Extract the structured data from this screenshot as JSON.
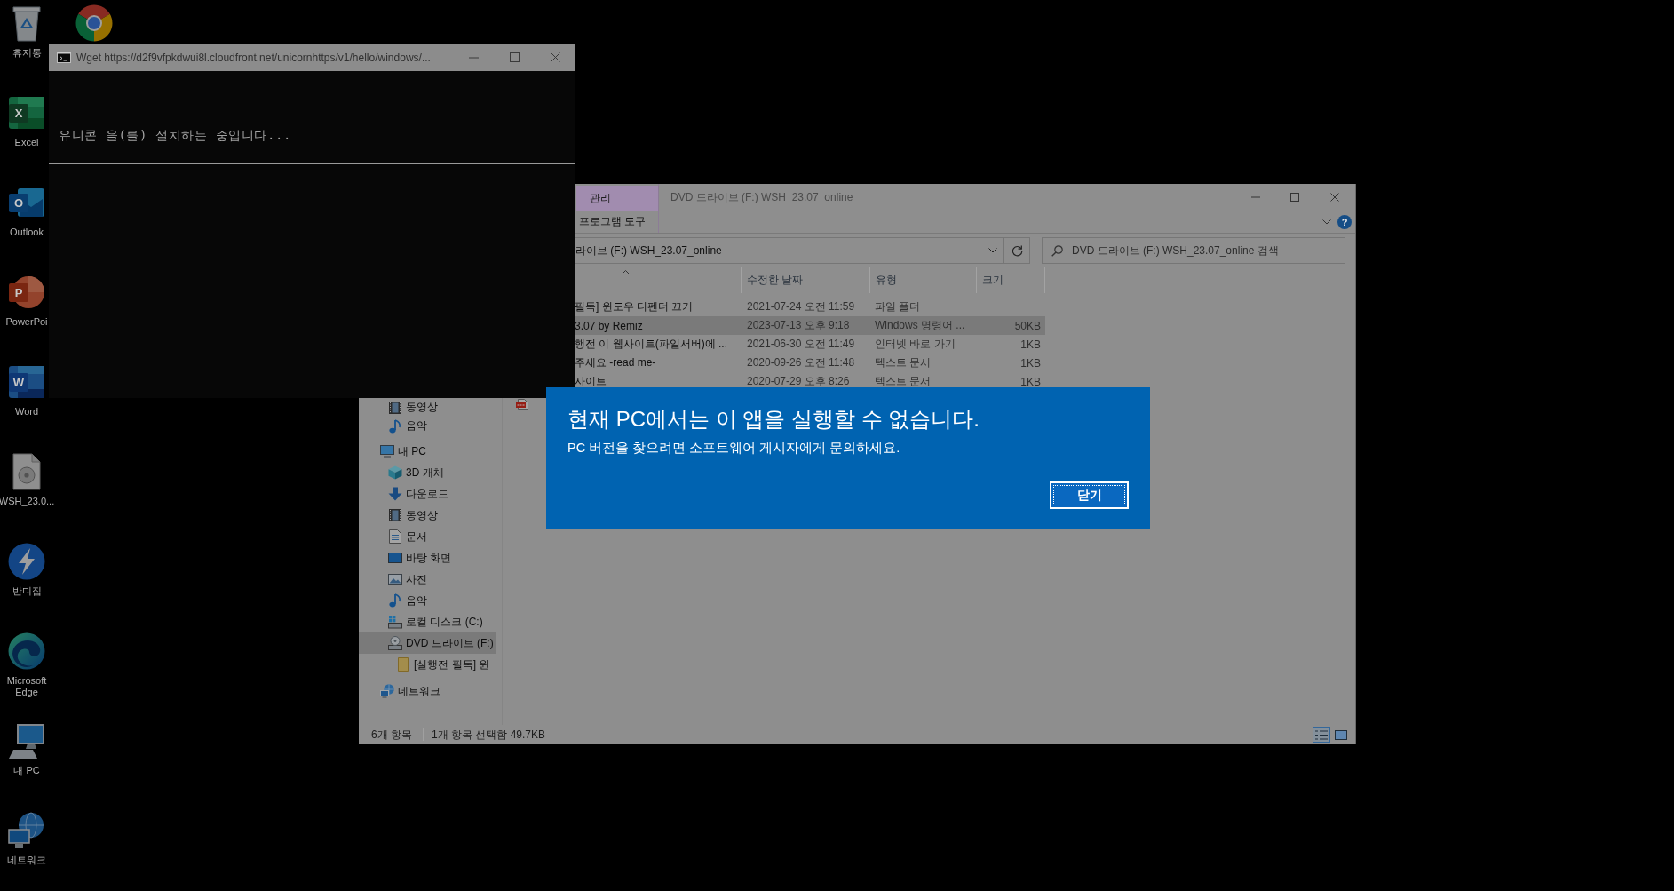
{
  "desktop_icons": [
    {
      "kind": "recycle-bin",
      "label": "휴지통"
    },
    {
      "kind": "spreadsheet",
      "glyph": "X",
      "label": "Excel"
    },
    {
      "kind": "mail",
      "glyph": "O",
      "label": "Outlook"
    },
    {
      "kind": "slides",
      "glyph": "P",
      "label": "PowerPoi"
    },
    {
      "kind": "word-processor",
      "glyph": "W",
      "label": "Word"
    },
    {
      "kind": "disc-file",
      "label": "WSH_23.0..."
    },
    {
      "kind": "lightning",
      "label": "반디집"
    },
    {
      "kind": "swirl",
      "label": "Microsoft Edge"
    },
    {
      "kind": "computer",
      "label": "내 PC"
    },
    {
      "kind": "network",
      "label": "네트워크"
    },
    {
      "kind": "browser"
    }
  ],
  "console": {
    "title": "Wget https://d2f9vfpkdwui8l.cloudfront.net/unicornhttps/v1/hello/windows/...",
    "message": "유니콘 을(를) 설치하는 중입니다..."
  },
  "explorer": {
    "title": "DVD 드라이브 (F:) WSH_23.07_online",
    "ribbon": {
      "context_header": "관리",
      "tab": "프로그램 도구",
      "help": "?"
    },
    "address": "라이브 (F:) WSH_23.07_online",
    "search": {
      "placeholder": "DVD 드라이브 (F:) WSH_23.07_online 검색"
    },
    "columns": [
      "수정한 날짜",
      "유형",
      "크기"
    ],
    "rows": [
      {
        "kind": "folder",
        "name": "필독] 윈도우 디펜더 끄기",
        "date": "2021-07-24 오전 11:59",
        "type": "파일 폴더",
        "selected": false
      },
      {
        "kind": "script",
        "name": "3.07 by Remiz",
        "date": "2023-07-13 오후 9:18",
        "type": "Windows 명령어 ...",
        "size": "50KB",
        "selected": true
      },
      {
        "kind": "shortcut",
        "name": "행전 이 웹사이트(파일서버)에 ...",
        "date": "2021-06-30 오전 11:49",
        "type": "인터넷 바로 가기",
        "size": "1KB",
        "selected": false
      },
      {
        "kind": "text",
        "name": "주세요 -read me-",
        "date": "2020-09-26 오전 11:48",
        "type": "텍스트 문서",
        "size": "1KB",
        "selected": false
      },
      {
        "kind": "text",
        "name": "사이트",
        "date": "2020-07-29 오후 8:26",
        "type": "텍스트 문서",
        "size": "1KB",
        "selected": false
      },
      {
        "kind": "pdf",
        "selected": false
      }
    ],
    "nav": [
      {
        "children": [
          {
            "kind": "video",
            "label": "동영상",
            "selected": false
          },
          {
            "kind": "music",
            "label": "음악",
            "selected": false
          }
        ]
      },
      {
        "kind": "computer",
        "label": "내 PC",
        "selected": false,
        "children": [
          {
            "kind": "cube",
            "label": "3D 개체",
            "selected": false
          },
          {
            "kind": "download",
            "label": "다운로드",
            "selected": false
          },
          {
            "kind": "video",
            "label": "동영상",
            "selected": false
          },
          {
            "kind": "document",
            "label": "문서",
            "selected": false
          },
          {
            "kind": "desktop",
            "label": "바탕 화면",
            "selected": false
          },
          {
            "kind": "picture",
            "label": "사진",
            "selected": false
          },
          {
            "kind": "music",
            "label": "음악",
            "selected": false
          },
          {
            "kind": "disk",
            "label": "로컬 디스크 (C:)",
            "selected": false
          },
          {
            "kind": "dvd",
            "label": "DVD 드라이브 (F:)",
            "selected": true,
            "children": [
              {
                "kind": "folder",
                "label": "[실행전 필독] 윈",
                "selected": false
              }
            ]
          }
        ]
      },
      {
        "kind": "network",
        "label": "네트워크",
        "selected": false
      }
    ],
    "status": {
      "count": "6개 항목",
      "selection": "1개 항목 선택함 49.7KB"
    },
    "views": [
      {
        "kind": "details",
        "selected": true
      },
      {
        "kind": "large-icons",
        "selected": false
      }
    ]
  },
  "dialog": {
    "title": "현재 PC에서는 이 앱을 실행할 수 없습니다.",
    "message": "PC 버전을 찾으려면 소프트웨어 게시자에게 문의하세요.",
    "button": "닫기"
  }
}
